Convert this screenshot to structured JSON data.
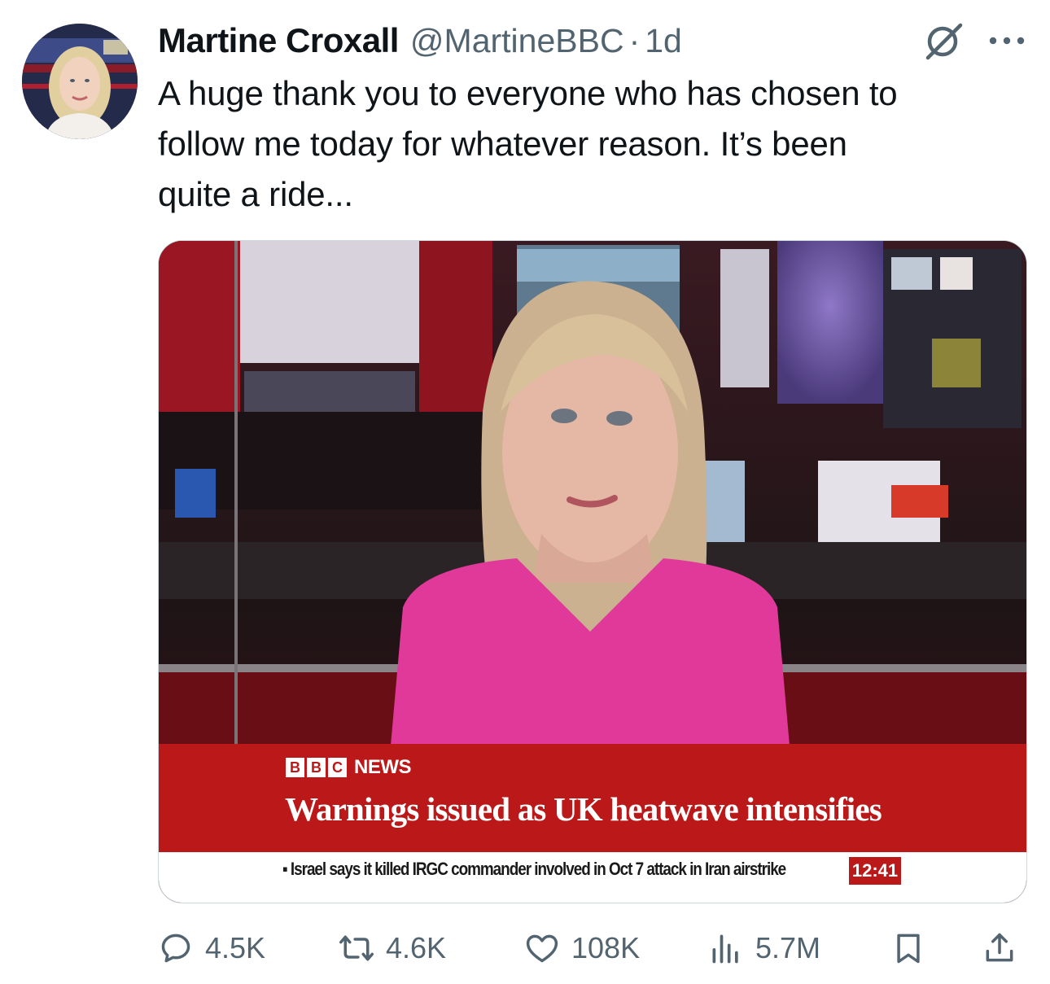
{
  "author": {
    "name": "Martine Croxall",
    "handle": "@MartineBBC",
    "separator": "·",
    "time": "1d"
  },
  "tweet": {
    "text": "A huge thank you to everyone who has chosen to\nfollow me today for whatever reason. It’s been\nquite a ride..."
  },
  "media": {
    "logo_letters": [
      "B",
      "B",
      "C"
    ],
    "logo_word": "NEWS",
    "headline": "Warnings issued as UK heatwave intensifies",
    "ticker": "▪ Israel says it killed IRGC commander involved in Oct 7 attack in Iran airstrike",
    "clock": "12:41"
  },
  "actions": {
    "replies": "4.5K",
    "reposts": "4.6K",
    "likes": "108K",
    "views": "5.7M"
  },
  "icons": {
    "grok": "grok-icon",
    "more": "more-icon",
    "reply": "reply-icon",
    "repost": "repost-icon",
    "like": "heart-icon",
    "views": "views-icon",
    "bookmark": "bookmark-icon",
    "share": "share-icon"
  },
  "colors": {
    "text": "#0f1419",
    "secondary": "#536471",
    "bbc_red": "#bb1919",
    "border": "#cfd9de"
  }
}
